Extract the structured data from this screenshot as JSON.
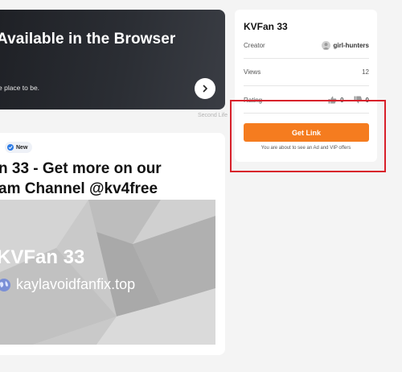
{
  "ad": {
    "title": "Available in the Browser",
    "subtitle": "e place to be.",
    "credit": "Second Life"
  },
  "post": {
    "badge": "New",
    "title_line1": "n 33 - Get more on our",
    "title_line2": "am Channel @kv4free",
    "image_heading": "KVFan 33",
    "image_url": "kaylavoidfanfix.top"
  },
  "info": {
    "title": "KVFan 33",
    "creator_label": "Creator",
    "creator_value": "girl-hunters",
    "views_label": "Views",
    "views_value": "12",
    "rating_label": "Rating",
    "likes": "0",
    "dislikes": "0",
    "button_label": "Get Link",
    "note": "You are about to see an Ad and VIP offers"
  },
  "colors": {
    "accent": "#f57c1f",
    "highlight": "#d8202a",
    "badge_dot": "#2d7be5"
  }
}
